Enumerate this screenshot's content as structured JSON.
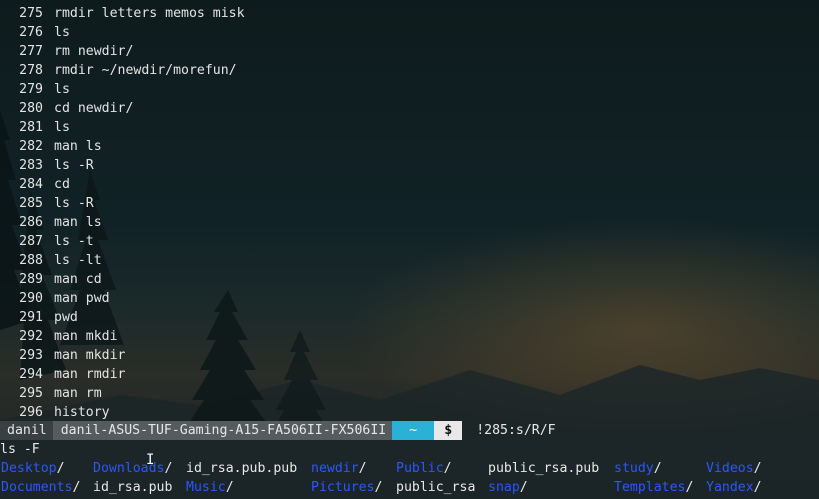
{
  "history": [
    {
      "num": "275",
      "cmd": "rmdir letters memos misk"
    },
    {
      "num": "276",
      "cmd": "ls"
    },
    {
      "num": "277",
      "cmd": "rm newdir/"
    },
    {
      "num": "278",
      "cmd": "rmdir ~/newdir/morefun/"
    },
    {
      "num": "279",
      "cmd": "ls"
    },
    {
      "num": "280",
      "cmd": "cd newdir/"
    },
    {
      "num": "281",
      "cmd": "ls"
    },
    {
      "num": "282",
      "cmd": "man ls"
    },
    {
      "num": "283",
      "cmd": "ls -R"
    },
    {
      "num": "284",
      "cmd": "cd"
    },
    {
      "num": "285",
      "cmd": "ls -R"
    },
    {
      "num": "286",
      "cmd": "man ls"
    },
    {
      "num": "287",
      "cmd": "ls -t"
    },
    {
      "num": "288",
      "cmd": "ls -lt"
    },
    {
      "num": "289",
      "cmd": "man cd"
    },
    {
      "num": "290",
      "cmd": "man pwd"
    },
    {
      "num": "291",
      "cmd": "pwd"
    },
    {
      "num": "292",
      "cmd": "man mkdi"
    },
    {
      "num": "293",
      "cmd": "man mkdir"
    },
    {
      "num": "294",
      "cmd": "man rmdir"
    },
    {
      "num": "295",
      "cmd": "man rm"
    },
    {
      "num": "296",
      "cmd": "history"
    }
  ],
  "prompt": {
    "user": "danil",
    "host": "danil-ASUS-TUF-Gaming-A15-FA506II-FX506II",
    "dir": "~",
    "symbol": "$",
    "command": "!285:s/R/F"
  },
  "expanded_command": "ls -F",
  "ls_output": {
    "row1": [
      {
        "name": "Desktop",
        "suffix": "/",
        "type": "dir"
      },
      {
        "name": "Downloads",
        "suffix": "/",
        "type": "dir"
      },
      {
        "name": "id_rsa.pub.pub",
        "suffix": "",
        "type": "file"
      },
      {
        "name": "newdir",
        "suffix": "/",
        "type": "dir"
      },
      {
        "name": "Public",
        "suffix": "/",
        "type": "dir"
      },
      {
        "name": "public_rsa.pub",
        "suffix": "",
        "type": "file"
      },
      {
        "name": "study",
        "suffix": "/",
        "type": "dir"
      },
      {
        "name": "Videos",
        "suffix": "/",
        "type": "dir"
      }
    ],
    "row2": [
      {
        "name": "Documents",
        "suffix": "/",
        "type": "dir"
      },
      {
        "name": "id_rsa.pub",
        "suffix": "",
        "type": "file"
      },
      {
        "name": "Music",
        "suffix": "/",
        "type": "dir"
      },
      {
        "name": "Pictures",
        "suffix": "/",
        "type": "dir"
      },
      {
        "name": "public_rsa",
        "suffix": "",
        "type": "file"
      },
      {
        "name": "snap",
        "suffix": "/",
        "type": "dir"
      },
      {
        "name": "Templates",
        "suffix": "/",
        "type": "dir"
      },
      {
        "name": "Yandex",
        "suffix": "/",
        "type": "dir"
      }
    ]
  },
  "colors": {
    "directory": "#2b57ff",
    "prompt_dir_bg": "#2bb0d6",
    "prompt_host_bg": "#565b5e",
    "prompt_user_bg": "#3a3f42"
  },
  "icons": {
    "cursor": "text-cursor-icon"
  }
}
